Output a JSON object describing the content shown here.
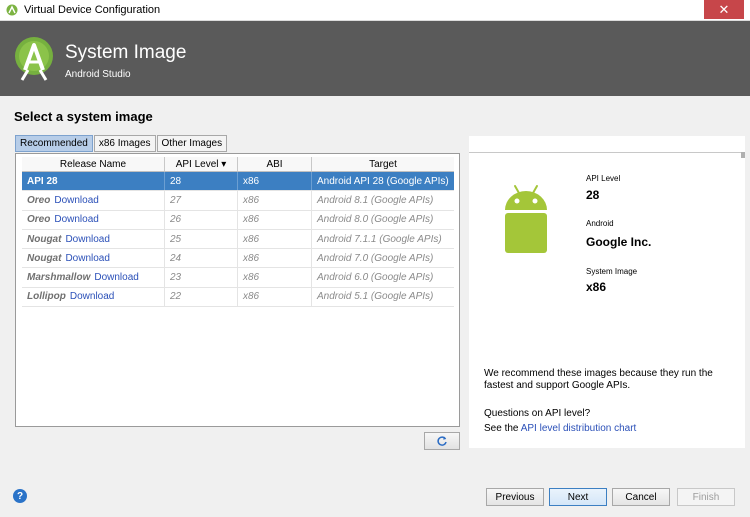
{
  "window": {
    "title": "Virtual Device Configuration",
    "close_glyph": "✕"
  },
  "header": {
    "title": "System Image",
    "subtitle": "Android Studio"
  },
  "section_title": "Select a system image",
  "tabs": [
    {
      "label": "Recommended",
      "active": true
    },
    {
      "label": "x86 Images",
      "active": false
    },
    {
      "label": "Other Images",
      "active": false
    }
  ],
  "table": {
    "columns": [
      "Release Name",
      "API Level ▾",
      "ABI",
      "Target"
    ],
    "rows": [
      {
        "name": "API 28",
        "download": "",
        "api": "28",
        "abi": "x86",
        "target": "Android API 28 (Google APIs)",
        "selected": true
      },
      {
        "name": "Oreo",
        "download": "Download",
        "api": "27",
        "abi": "x86",
        "target": "Android 8.1 (Google APIs)",
        "selected": false
      },
      {
        "name": "Oreo",
        "download": "Download",
        "api": "26",
        "abi": "x86",
        "target": "Android 8.0 (Google APIs)",
        "selected": false
      },
      {
        "name": "Nougat",
        "download": "Download",
        "api": "25",
        "abi": "x86",
        "target": "Android 7.1.1 (Google APIs)",
        "selected": false
      },
      {
        "name": "Nougat",
        "download": "Download",
        "api": "24",
        "abi": "x86",
        "target": "Android 7.0 (Google APIs)",
        "selected": false
      },
      {
        "name": "Marshmallow",
        "download": "Download",
        "api": "23",
        "abi": "x86",
        "target": "Android 6.0 (Google APIs)",
        "selected": false
      },
      {
        "name": "Lollipop",
        "download": "Download",
        "api": "22",
        "abi": "x86",
        "target": "Android 5.1 (Google APIs)",
        "selected": false
      }
    ]
  },
  "detail": {
    "api_level_label": "API Level",
    "api_level_value": "28",
    "android_label": "Android",
    "android_value": "Google Inc.",
    "system_image_label": "System Image",
    "system_image_value": "x86",
    "recommend_text": "We recommend these images because they run the fastest and support Google APIs.",
    "question_text": "Questions on API level?",
    "see_prefix": "See the",
    "see_link": "API level distribution chart"
  },
  "footer": {
    "help_glyph": "?",
    "previous_label": "Previous",
    "next_label": "Next",
    "cancel_label": "Cancel",
    "finish_label": "Finish"
  },
  "colors": {
    "selection": "#3c7fc2",
    "header_bg": "#5a5a5a",
    "android_green": "#a4c639",
    "link": "#2b50b8"
  },
  "icons": {
    "app": "android-studio-icon",
    "logo": "android-studio-logo",
    "refresh": "refresh-icon",
    "help": "help-icon",
    "android": "android-robot-icon"
  }
}
